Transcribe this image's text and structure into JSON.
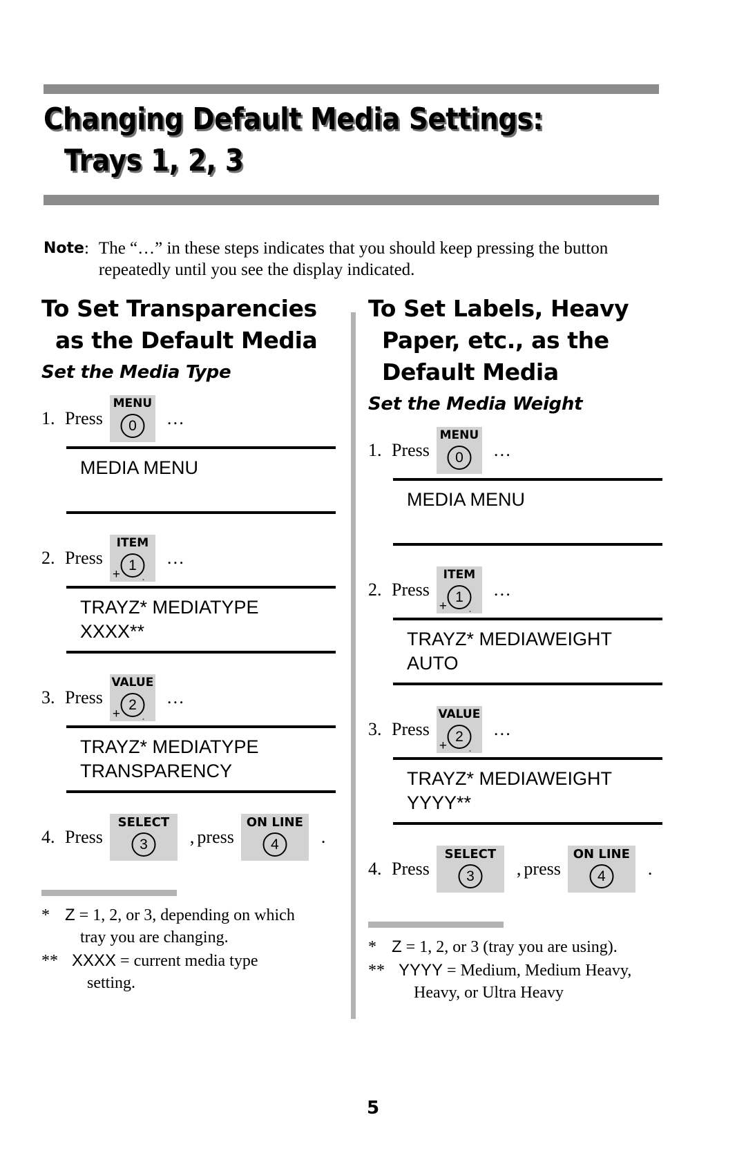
{
  "document": {
    "title_line_1": "Changing Default Media Settings:",
    "title_line_2": "Trays 1, 2, 3",
    "page_number": "5"
  },
  "note": {
    "label": "Note",
    "colon": ":",
    "line_1": "The “…” in these steps indicates that you should keep pressing the button",
    "line_2": "repeatedly until you see the display indicated."
  },
  "left_column": {
    "heading_line_1": "To Set Transparencies",
    "heading_line_2": "as the Default Media",
    "subheading": "Set the Media Type",
    "steps": [
      {
        "number": "1.",
        "word": "Press",
        "dots": "…",
        "key": {
          "label": "MENU",
          "digit": "0",
          "plus": "",
          "dot": "",
          "wide": false
        }
      },
      {
        "number": "2.",
        "word": "Press",
        "dots": "…",
        "key": {
          "label": "ITEM",
          "digit": "1",
          "plus": "+",
          "dot": ".",
          "wide": false
        }
      },
      {
        "number": "3.",
        "word": "Press",
        "dots": "…",
        "key": {
          "label": "VALUE",
          "digit": "2",
          "plus": "+",
          "dot": ".",
          "wide": false
        }
      }
    ],
    "displays": [
      {
        "line_1": "MEDIA MENU",
        "line_2": ""
      },
      {
        "line_1": "TRAYZ* MEDIATYPE",
        "line_2": "XXXX**"
      },
      {
        "line_1": "TRAYZ* MEDIATYPE",
        "line_2": "TRANSPARENCY"
      }
    ],
    "final_step": {
      "number": "4.",
      "word": "Press",
      "separator": ",",
      "word_2": "press",
      "period": ".",
      "key_1": {
        "label": "SELECT",
        "digit": "3"
      },
      "key_2": {
        "label": "ON LINE",
        "digit": "4"
      }
    },
    "footnotes": [
      {
        "mark": "*",
        "line_1": "Z = 1, 2, or 3, depending on which",
        "line_2": "tray you are changing.",
        "sans_prefix": "Z",
        "rest_1": " = 1, 2, or 3, depending on which"
      },
      {
        "mark": "**",
        "line_1": "XXXX = current media type",
        "line_2": "setting.",
        "sans_prefix": "XXXX",
        "rest_1": " = current media type"
      }
    ]
  },
  "right_column": {
    "heading_line_1": "To Set Labels, Heavy",
    "heading_line_2": "Paper, etc., as the",
    "heading_line_3": "Default Media",
    "subheading": "Set the Media Weight",
    "steps": [
      {
        "number": "1.",
        "word": "Press",
        "dots": "…",
        "key": {
          "label": "MENU",
          "digit": "0",
          "plus": "",
          "dot": "",
          "wide": false
        }
      },
      {
        "number": "2.",
        "word": "Press",
        "dots": "…",
        "key": {
          "label": "ITEM",
          "digit": "1",
          "plus": "+",
          "dot": ".",
          "wide": false
        }
      },
      {
        "number": "3.",
        "word": "Press",
        "dots": "…",
        "key": {
          "label": "VALUE",
          "digit": "2",
          "plus": "+",
          "dot": ".",
          "wide": false
        }
      }
    ],
    "displays": [
      {
        "line_1": "MEDIA MENU",
        "line_2": ""
      },
      {
        "line_1": "TRAYZ* MEDIAWEIGHT",
        "line_2": "AUTO"
      },
      {
        "line_1": "TRAYZ* MEDIAWEIGHT",
        "line_2": "YYYY**"
      }
    ],
    "final_step": {
      "number": "4.",
      "word": "Press",
      "separator": ",",
      "word_2": "press",
      "period": ".",
      "key_1": {
        "label": "SELECT",
        "digit": "3"
      },
      "key_2": {
        "label": "ON LINE",
        "digit": "4"
      }
    },
    "footnotes": [
      {
        "mark": "*",
        "line_1": "Z = 1, 2, or 3 (tray you are using).",
        "line_2": "",
        "sans_prefix": "Z",
        "rest_1": " = 1, 2, or 3 (tray you are using)."
      },
      {
        "mark": "**",
        "line_1": "YYYY = Medium, Medium Heavy,",
        "line_2": "Heavy, or Ultra Heavy",
        "sans_prefix": "YYYY",
        "rest_1": " = Medium, Medium Heavy,"
      }
    ]
  },
  "colors": {
    "rule_gray": "#8c8c8c",
    "key_gray": "#d2d2d2",
    "divider_gray": "#b3b3b3",
    "text_black": "#000000"
  }
}
